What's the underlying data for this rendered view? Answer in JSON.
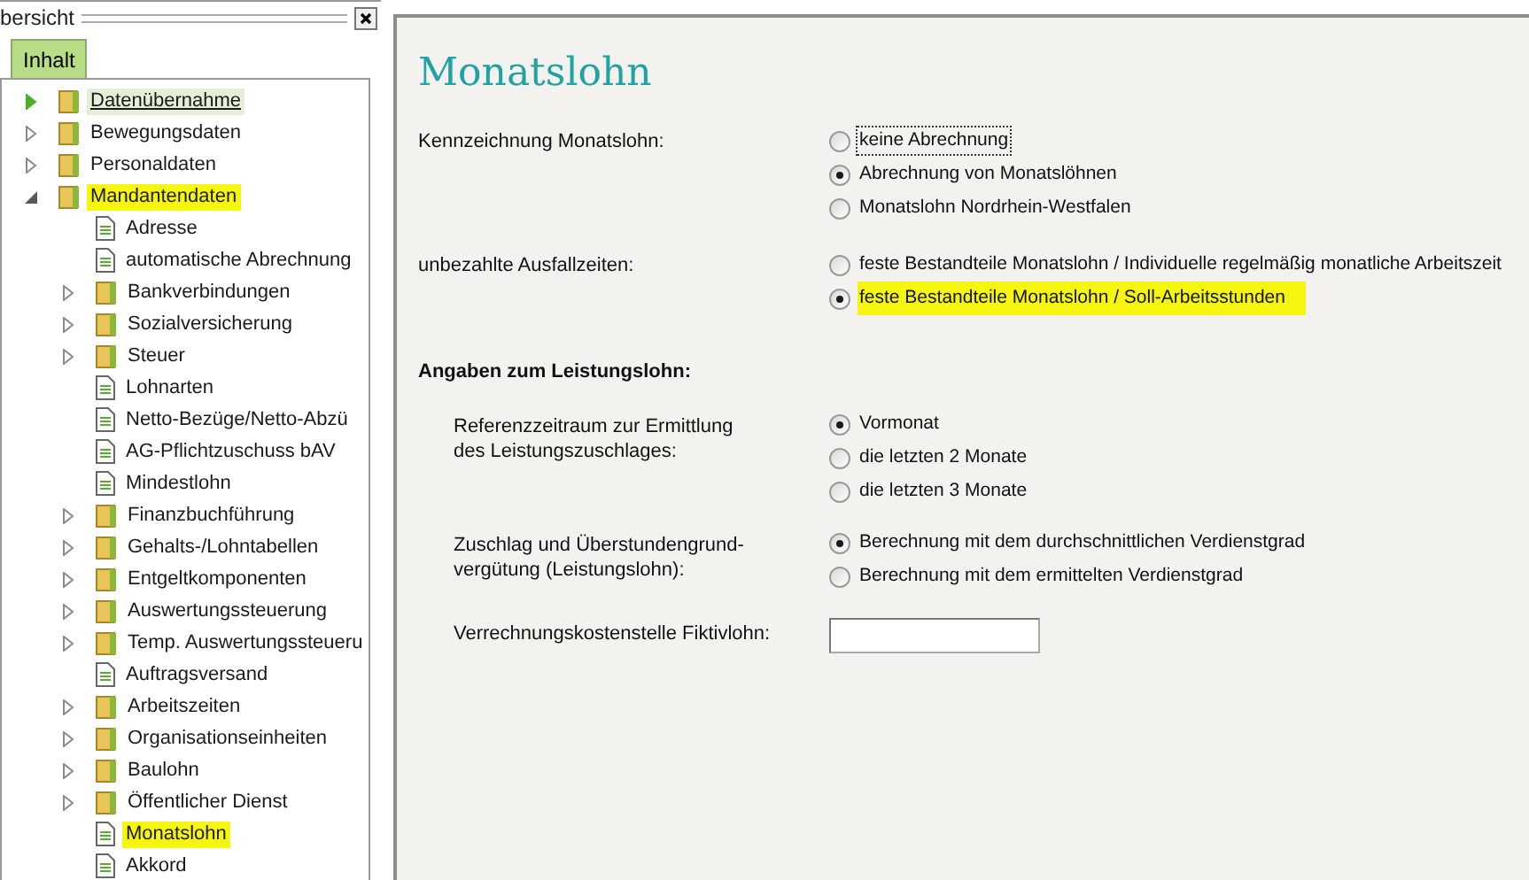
{
  "sidebar": {
    "title": "bersicht",
    "tabs": [
      {
        "label": "Inhalt",
        "selected": true
      }
    ],
    "tree": [
      {
        "label": "Datenübernahme",
        "kind": "folder",
        "expanded": false,
        "hovered": true,
        "highlighted": false
      },
      {
        "label": "Bewegungsdaten",
        "kind": "folder",
        "expanded": false,
        "hovered": false,
        "highlighted": false
      },
      {
        "label": "Personaldaten",
        "kind": "folder",
        "expanded": false,
        "hovered": false,
        "highlighted": false
      },
      {
        "label": "Mandantendaten",
        "kind": "folder",
        "expanded": true,
        "hovered": false,
        "highlighted": true,
        "children": [
          {
            "label": "Adresse",
            "kind": "document",
            "hovered": false,
            "highlighted": false
          },
          {
            "label": "automatische Abrechnung",
            "kind": "document",
            "hovered": false,
            "highlighted": false
          },
          {
            "label": "Bankverbindungen",
            "kind": "folder",
            "expanded": false,
            "hovered": false,
            "highlighted": false
          },
          {
            "label": "Sozialversicherung",
            "kind": "folder",
            "expanded": false,
            "hovered": false,
            "highlighted": false
          },
          {
            "label": "Steuer",
            "kind": "folder",
            "expanded": false,
            "hovered": false,
            "highlighted": false
          },
          {
            "label": "Lohnarten",
            "kind": "document",
            "hovered": false,
            "highlighted": false
          },
          {
            "label": "Netto-Bezüge/Netto-Abzü",
            "kind": "document",
            "hovered": false,
            "highlighted": false
          },
          {
            "label": "AG-Pflichtzuschuss bAV",
            "kind": "document",
            "hovered": false,
            "highlighted": false
          },
          {
            "label": "Mindestlohn",
            "kind": "document",
            "hovered": false,
            "highlighted": false
          },
          {
            "label": "Finanzbuchführung",
            "kind": "folder",
            "expanded": false,
            "hovered": false,
            "highlighted": false
          },
          {
            "label": "Gehalts-/Lohntabellen",
            "kind": "folder",
            "expanded": false,
            "hovered": false,
            "highlighted": false
          },
          {
            "label": "Entgeltkomponenten",
            "kind": "folder",
            "expanded": false,
            "hovered": false,
            "highlighted": false
          },
          {
            "label": "Auswertungssteuerung",
            "kind": "folder",
            "expanded": false,
            "hovered": false,
            "highlighted": false
          },
          {
            "label": "Temp. Auswertungssteueru",
            "kind": "folder",
            "expanded": false,
            "hovered": false,
            "highlighted": false
          },
          {
            "label": "Auftragsversand",
            "kind": "document",
            "hovered": false,
            "highlighted": false
          },
          {
            "label": "Arbeitszeiten",
            "kind": "folder",
            "expanded": false,
            "hovered": false,
            "highlighted": false
          },
          {
            "label": "Organisationseinheiten",
            "kind": "folder",
            "expanded": false,
            "hovered": false,
            "highlighted": false
          },
          {
            "label": "Baulohn",
            "kind": "folder",
            "expanded": false,
            "hovered": false,
            "highlighted": false
          },
          {
            "label": "Öffentlicher Dienst",
            "kind": "folder",
            "expanded": false,
            "hovered": false,
            "highlighted": false
          },
          {
            "label": "Monatslohn",
            "kind": "document",
            "hovered": false,
            "highlighted": true
          },
          {
            "label": "Akkord",
            "kind": "document",
            "hovered": false,
            "highlighted": false
          }
        ]
      }
    ]
  },
  "page": {
    "title": "Monatslohn",
    "groups": [
      {
        "label": "Kennzeichnung Monatslohn:",
        "options": [
          {
            "label": "keine Abrechnung",
            "selected": false,
            "focused": true,
            "highlighted": false
          },
          {
            "label": "Abrechnung von Monatslöhnen",
            "selected": true,
            "focused": false,
            "highlighted": false
          },
          {
            "label": "Monatslohn Nordrhein-Westfalen",
            "selected": false,
            "focused": false,
            "highlighted": false
          }
        ]
      },
      {
        "label": "unbezahlte Ausfallzeiten:",
        "options": [
          {
            "label": "feste Bestandteile Monatslohn / Individuelle regelmäßig monatliche Arbeitszeit",
            "selected": false,
            "focused": false,
            "highlighted": false
          },
          {
            "label": "feste Bestandteile Monatslohn / Soll-Arbeitsstunden",
            "selected": true,
            "focused": false,
            "highlighted": true
          }
        ]
      }
    ],
    "section": {
      "title": "Angaben zum Leistungslohn:",
      "groups": [
        {
          "label": "Referenzzeitraum zur Ermittlung des Leistungszuschlages:",
          "options": [
            {
              "label": "Vormonat",
              "selected": true,
              "focused": false,
              "highlighted": false
            },
            {
              "label": "die letzten 2 Monate",
              "selected": false,
              "focused": false,
              "highlighted": false
            },
            {
              "label": "die letzten 3 Monate",
              "selected": false,
              "focused": false,
              "highlighted": false
            }
          ]
        },
        {
          "label": "Zuschlag und Überstundengrund-vergütung (Leistungslohn):",
          "options": [
            {
              "label": "Berechnung mit dem durchschnittlichen Verdienstgrad",
              "selected": true,
              "focused": false,
              "highlighted": false
            },
            {
              "label": "Berechnung mit dem ermittelten Verdienstgrad",
              "selected": false,
              "focused": false,
              "highlighted": false
            }
          ]
        }
      ],
      "field": {
        "label": "Verrechnungskostenstelle Fiktivlohn:"
      }
    }
  }
}
